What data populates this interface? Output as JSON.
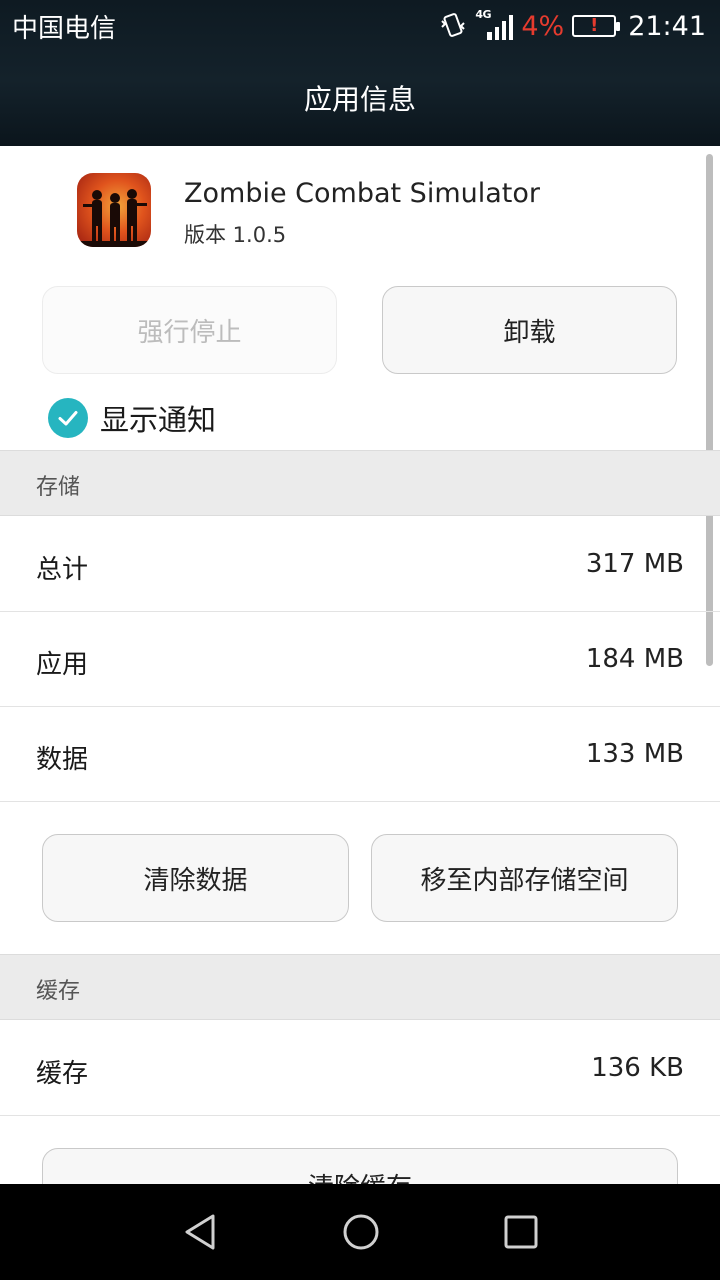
{
  "status_bar": {
    "carrier": "中国电信",
    "network": "4G",
    "battery_percent": "4%",
    "battery_alert": "!",
    "time": "21:41"
  },
  "header": {
    "title": "应用信息"
  },
  "app": {
    "name": "Zombie Combat Simulator",
    "version": "版本 1.0.5"
  },
  "actions": {
    "force_stop": "强行停止",
    "uninstall": "卸载"
  },
  "notification": {
    "label": "显示通知",
    "checked": true
  },
  "storage": {
    "section_title": "存储",
    "rows": [
      {
        "label": "总计",
        "value": "317 MB"
      },
      {
        "label": "应用",
        "value": "184 MB"
      },
      {
        "label": "数据",
        "value": "133 MB"
      }
    ],
    "clear_data": "清除数据",
    "move_storage": "移至内部存储空间"
  },
  "cache": {
    "section_title": "缓存",
    "rows": [
      {
        "label": "缓存",
        "value": "136 KB"
      }
    ],
    "clear_cache": "清除缓存"
  },
  "colors": {
    "accent": "#26b5c0",
    "battery_low": "#e53b2e"
  },
  "nav_bar": {
    "icons": [
      "back-icon",
      "home-icon",
      "recents-icon"
    ]
  }
}
